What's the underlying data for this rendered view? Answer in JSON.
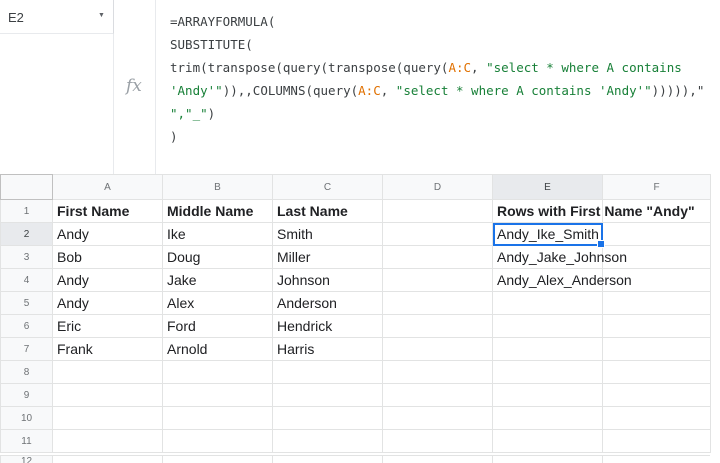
{
  "name_box": {
    "ref": "E2"
  },
  "formula_bar": {
    "fx_label": "fx",
    "lines": [
      [
        {
          "t": "=ARRAYFORMULA(",
          "c": ""
        }
      ],
      [
        {
          "t": "SUBSTITUTE(",
          "c": ""
        }
      ],
      [
        {
          "t": "trim(transpose(query(transpose(query(",
          "c": ""
        },
        {
          "t": "A:C",
          "c": "rng"
        },
        {
          "t": ", ",
          "c": ""
        },
        {
          "t": "\"select * where A contains",
          "c": "str"
        }
      ],
      [
        {
          "t": "'Andy'\"",
          "c": "str"
        },
        {
          "t": ")),,COLUMNS(query(",
          "c": ""
        },
        {
          "t": "A:C",
          "c": "rng"
        },
        {
          "t": ", ",
          "c": ""
        },
        {
          "t": "\"select * where A contains 'Andy'\"",
          "c": "str"
        },
        {
          "t": "))))),\"",
          "c": ""
        }
      ],
      [
        {
          "t": "\",\"_\"",
          "c": "str"
        },
        {
          "t": ")",
          "c": ""
        }
      ],
      [
        {
          "t": ")",
          "c": ""
        }
      ]
    ]
  },
  "grid": {
    "columns": [
      "A",
      "B",
      "C",
      "D",
      "E",
      "F"
    ],
    "rows": [
      [
        "First Name",
        "Middle Name",
        "Last Name",
        "",
        "Rows with First Name \"Andy\"",
        ""
      ],
      [
        "Andy",
        "Ike",
        "Smith",
        "",
        "Andy_Ike_Smith",
        ""
      ],
      [
        "Bob",
        "Doug",
        "Miller",
        "",
        "Andy_Jake_Johnson",
        ""
      ],
      [
        "Andy",
        "Jake",
        "Johnson",
        "",
        "Andy_Alex_Anderson",
        ""
      ],
      [
        "Andy",
        "Alex",
        "Anderson",
        "",
        "",
        ""
      ],
      [
        "Eric",
        "Ford",
        "Hendrick",
        "",
        "",
        ""
      ],
      [
        "Frank",
        "Arnold",
        "Harris",
        "",
        "",
        ""
      ],
      [
        "",
        "",
        "",
        "",
        "",
        ""
      ],
      [
        "",
        "",
        "",
        "",
        "",
        ""
      ],
      [
        "",
        "",
        "",
        "",
        "",
        ""
      ],
      [
        "",
        "",
        "",
        "",
        "",
        ""
      ]
    ],
    "row_numbers": [
      "1",
      "2",
      "3",
      "4",
      "5",
      "6",
      "7",
      "8",
      "9",
      "10",
      "11",
      "12"
    ],
    "selected": {
      "row": 2,
      "col": "E"
    }
  }
}
